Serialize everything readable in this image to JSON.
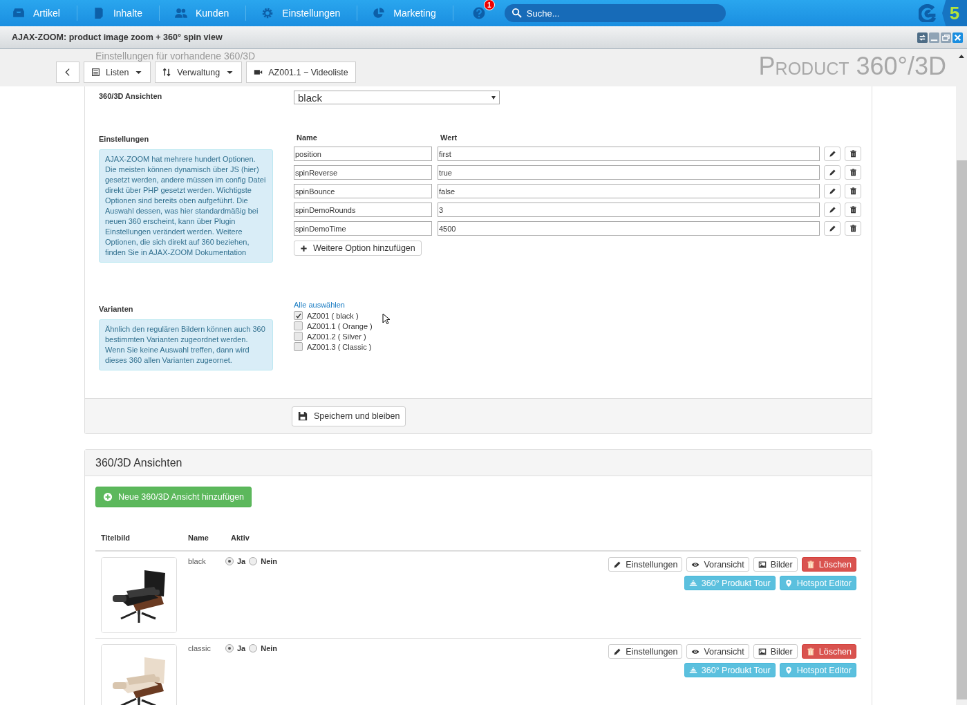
{
  "top_nav": {
    "items": [
      {
        "label": "Artikel"
      },
      {
        "label": "Inhalte"
      },
      {
        "label": "Kunden"
      },
      {
        "label": "Einstellungen"
      },
      {
        "label": "Marketing"
      }
    ],
    "notification_count": "1",
    "search": {
      "placeholder": "Suche..."
    },
    "brand_badge": "5"
  },
  "window": {
    "title": "AJAX-ZOOM: product image zoom + 360° spin view"
  },
  "page_header": {
    "faded_heading": "Einstellungen für vorhandene 360/3D",
    "title": "Product 360°/3D",
    "toolbar": [
      {
        "kind": "back"
      },
      {
        "kind": "dropdown",
        "label": "Listen"
      },
      {
        "kind": "dropdown",
        "label": "Verwaltung"
      },
      {
        "kind": "link",
        "label": "AZ001.1 − Videoliste"
      }
    ]
  },
  "settings_form": {
    "view_label": "360/3D Ansichten",
    "view_select": {
      "value": "black"
    },
    "options_label": "Einstellungen",
    "options_info": "AJAX-ZOOM hat mehrere hundert Optionen. Die meisten können dynamisch über JS (hier) gesetzt werden, andere müssen im config Datei direkt über PHP gesetzt werden. Wichtigste Optionen sind bereits oben aufgeführt. Die Auswahl dessen, was hier standardmäßig bei neuen 360 erscheint, kann über Plugin Einstellungen verändert werden. Weitere Optionen, die sich direkt auf 360 beziehen, finden Sie in AJAX-ZOOM Dokumentation",
    "option_columns": [
      "Name",
      "Wert"
    ],
    "options": [
      {
        "name": "position",
        "value": "first"
      },
      {
        "name": "spinReverse",
        "value": "true"
      },
      {
        "name": "spinBounce",
        "value": "false"
      },
      {
        "name": "spinDemoRounds",
        "value": "3"
      },
      {
        "name": "spinDemoTime",
        "value": "4500"
      }
    ],
    "add_option_button": "Weitere Option hinzufügen",
    "variants_label": "Varianten",
    "variants_info": "Ähnlich den regulären Bildern können auch 360 bestimmten Varianten zugeordnet werden. Wenn Sie keine Auswahl treffen, dann wird dieses 360 allen Varianten zugeornet.",
    "select_all_link": "Alle auswählen",
    "variants": [
      {
        "label": "AZ001 ( black )",
        "checked": true
      },
      {
        "label": "AZ001.1 ( Orange )",
        "checked": false
      },
      {
        "label": "AZ001.2 ( Silver )",
        "checked": false
      },
      {
        "label": "AZ001.3 ( Classic )",
        "checked": false
      }
    ],
    "save_button": "Speichern und bleiben"
  },
  "views_panel": {
    "title": "360/3D Ansichten",
    "add_button": "Neue 360/3D Ansicht hinzufügen",
    "columns": [
      "Titelbild",
      "Name",
      "Aktiv"
    ],
    "rows": [
      {
        "thumbnail": {
          "kind": "picture"
        },
        "name": "black",
        "active_options": [
          {
            "label": "Ja",
            "selected": true
          },
          {
            "label": "Nein",
            "selected": false
          }
        ],
        "actions": [
          {
            "kind": "default",
            "label": "Einstellungen"
          },
          {
            "kind": "default",
            "label": "Voransicht"
          },
          {
            "kind": "default",
            "label": "Bilder"
          },
          {
            "kind": "danger",
            "label": "Löschen"
          },
          {
            "kind": "info",
            "label": "360° Produkt Tour"
          },
          {
            "kind": "info",
            "label": "Hotspot Editor"
          }
        ]
      },
      {
        "thumbnail": {
          "kind": "picture"
        },
        "name": "classic",
        "active_options": [
          {
            "label": "Ja",
            "selected": true
          },
          {
            "label": "Nein",
            "selected": false
          }
        ],
        "actions": [
          {
            "kind": "default",
            "label": "Einstellungen"
          },
          {
            "kind": "default",
            "label": "Voransicht"
          },
          {
            "kind": "default",
            "label": "Bilder"
          },
          {
            "kind": "danger",
            "label": "Löschen"
          },
          {
            "kind": "info",
            "label": "360° Produkt Tour"
          },
          {
            "kind": "info",
            "label": "Hotspot Editor"
          }
        ]
      }
    ]
  }
}
